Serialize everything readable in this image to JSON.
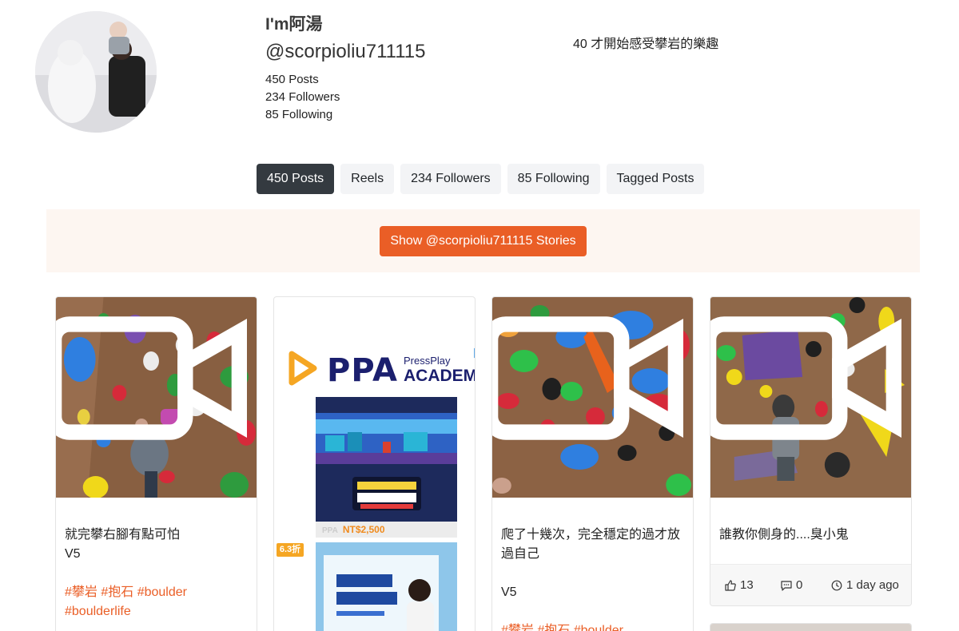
{
  "profile": {
    "display_name": "I'm阿湯",
    "username": "@scorpioliu711115",
    "posts": "450 Posts",
    "followers": "234 Followers",
    "following": "85 Following",
    "bio": "40 才開始感受攀岩的樂趣"
  },
  "tabs": [
    {
      "label": "450 Posts",
      "active": true
    },
    {
      "label": "Reels",
      "active": false
    },
    {
      "label": "234 Followers",
      "active": false
    },
    {
      "label": "85 Following",
      "active": false
    },
    {
      "label": "Tagged Posts",
      "active": false
    }
  ],
  "stories_button": "Show @scorpioliu711115 Stories",
  "posts": [
    {
      "lines": [
        "就完攀右腳有點可怕",
        "V5",
        ""
      ],
      "tags": [
        "#攀岩 #抱石 #boulder",
        "#boulderlife"
      ],
      "media": "video-icon"
    },
    {
      "lines": [
        "爬了十幾次，完全穩定的過才放",
        "過自己",
        "",
        "V5",
        ""
      ],
      "tags": [
        "#攀岩 #抱石 #boulder"
      ],
      "media": "video-icon"
    },
    {
      "lines": [
        "誰教你側身的....臭小鬼"
      ],
      "tags": [],
      "media": "video-icon",
      "likes": "13",
      "comments": "0",
      "time": "1 day ago"
    }
  ],
  "ad": {
    "brand": "PPA",
    "pressplay": "PressPlay",
    "academy": "ACADEMY",
    "product1_price": "NT$2,500",
    "product1_pp": "PPA",
    "discount": "6.3折",
    "choice_icon": "ad-choices-icon"
  },
  "colors": {
    "accent": "#ea5e26",
    "active_tab": "#343a40",
    "stories_bg": "#fdf6f1"
  }
}
